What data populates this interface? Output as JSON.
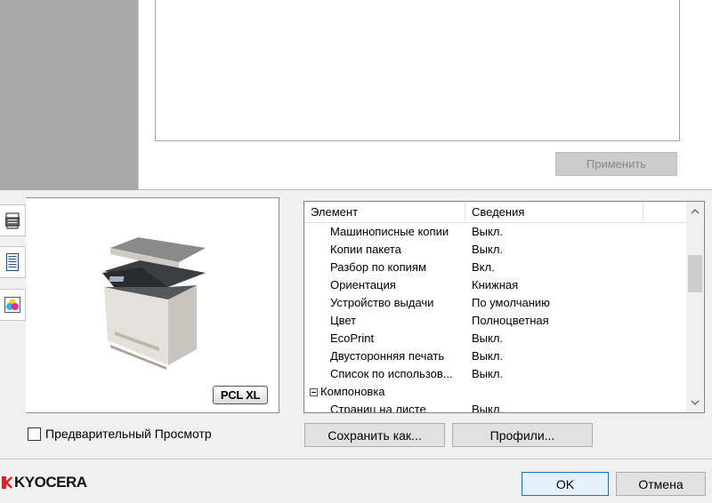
{
  "top": {
    "apply_label": "Применить"
  },
  "preview": {
    "badge": "PCL XL",
    "checkbox_label": "Предварительный Просмотр",
    "checked": false
  },
  "table": {
    "headers": [
      "Элемент",
      "Сведения"
    ],
    "rows": [
      {
        "name": "Машинописные копии",
        "value": "Выкл."
      },
      {
        "name": "Копии пакета",
        "value": "Выкл."
      },
      {
        "name": "Разбор по копиям",
        "value": "Вкл."
      },
      {
        "name": "Ориентация",
        "value": "Книжная"
      },
      {
        "name": "Устройство выдачи",
        "value": "По умолчанию"
      },
      {
        "name": "Цвет",
        "value": "Полноцветная"
      },
      {
        "name": "EcoPrint",
        "value": "Выкл."
      },
      {
        "name": "Двусторонняя печать",
        "value": "Выкл."
      },
      {
        "name": "Список по использов...",
        "value": "Выкл."
      }
    ],
    "group": {
      "name": "Компоновка"
    },
    "partial_row": {
      "name": "Страниц на листе",
      "value": "Выкл."
    }
  },
  "buttons": {
    "save": "Сохранить как...",
    "profiles": "Профили...",
    "ok": "OK",
    "cancel": "Отмена"
  },
  "brand": {
    "name": "KYOCERA",
    "color": "#d9252a"
  },
  "icons": [
    "printer-tab-icon",
    "document-tab-icon",
    "color-tab-icon",
    "minus-expander-icon",
    "scroll-up-icon",
    "scroll-down-icon"
  ]
}
